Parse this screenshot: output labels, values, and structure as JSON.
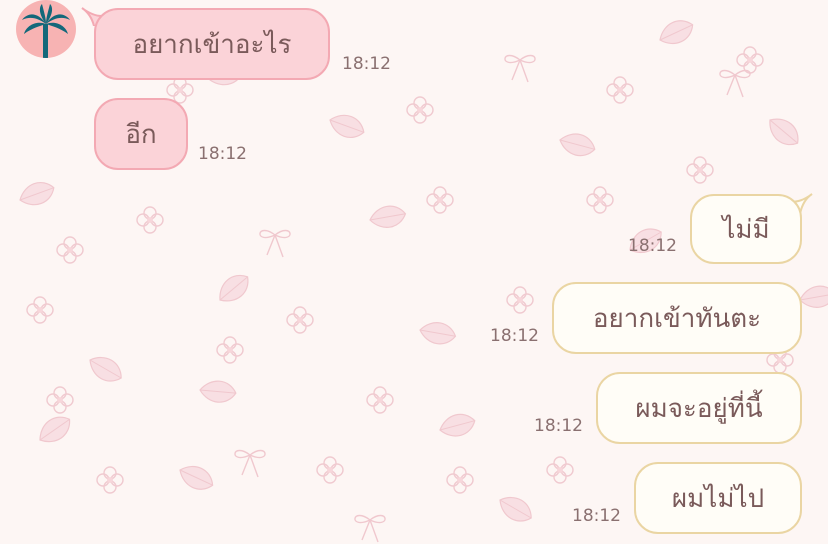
{
  "theme": {
    "incoming_bubble": "#fbd3d8",
    "incoming_border": "#f3a9b3",
    "outgoing_bubble": "#fffdf7",
    "outgoing_border": "#ead5a3",
    "text_color": "#7a5a5a",
    "background": "#fdf6f4"
  },
  "contact": {
    "avatar_icon": "palm-tree-icon"
  },
  "messages": [
    {
      "direction": "incoming",
      "text": "อยากเข้าอะไร",
      "time": "18:12"
    },
    {
      "direction": "incoming",
      "text": "อีก",
      "time": "18:12"
    },
    {
      "direction": "outgoing",
      "text": "ไม่มี",
      "time": "18:12"
    },
    {
      "direction": "outgoing",
      "text": "อยากเข้าทันตะ",
      "time": "18:12"
    },
    {
      "direction": "outgoing",
      "text": "ผมจะอยู่ที่นี้",
      "time": "18:12"
    },
    {
      "direction": "outgoing",
      "text": "ผมไม่ไป",
      "time": "18:12"
    }
  ]
}
